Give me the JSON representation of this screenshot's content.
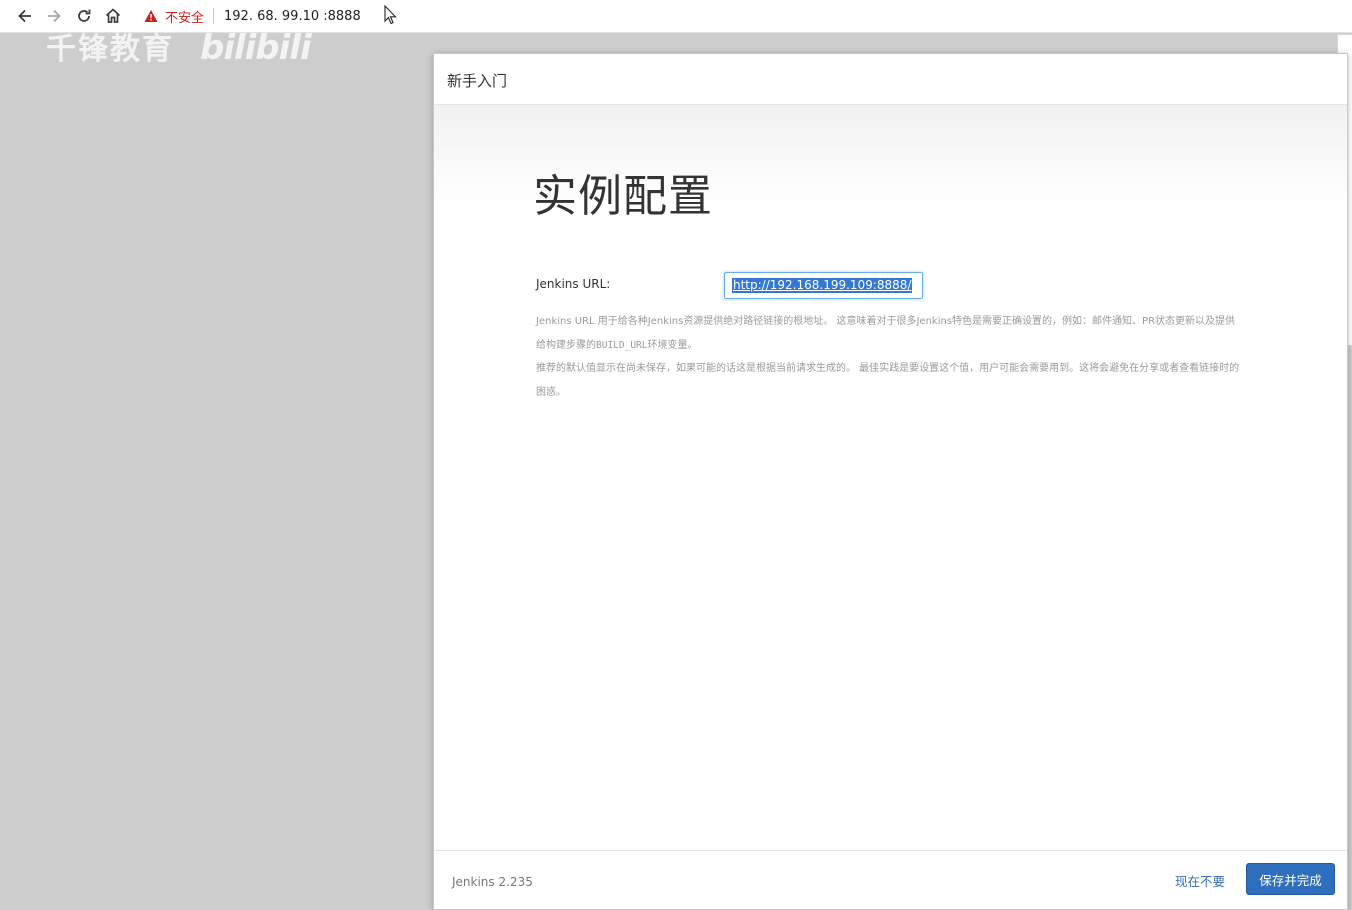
{
  "browser": {
    "back_icon": "arrow-left",
    "forward_icon": "arrow-right",
    "reload_icon": "reload",
    "home_icon": "home",
    "security_warning": "不安全",
    "address": "192.168.199.109:8888",
    "address_display": "192. 68. 99.10 :8888"
  },
  "watermark": {
    "text": "千锋教育",
    "logo": "bilibili"
  },
  "dialog": {
    "title": "新手入门",
    "heading": "实例配置",
    "url_label": "Jenkins URL:",
    "url_value": "http://192.168.199.109:8888/",
    "help_line1_a": "Jenkins URL 用于给各种Jenkins资源提供绝对路径链接的根地址。 这意味着对于很多Jenkins特色是需要正确设置的，例如：邮件通知、PR状态更新以及提供给构建步骤的",
    "help_line1_code": "BUILD_URL",
    "help_line1_b": "环境变量。",
    "help_line2": "推荐的默认值显示在尚未保存，如果可能的话这是根据当前请求生成的。 最佳实践是要设置这个值，用户可能会需要用到。这将会避免在分享或者查看链接时的困惑。",
    "version": "Jenkins 2.235",
    "skip_label": "现在不要",
    "save_label": "保存并完成"
  },
  "colors": {
    "primary_button": "#2d6ebd",
    "link": "#3b6fb6",
    "warning": "#c5221f",
    "background": "#cdcdcd"
  }
}
